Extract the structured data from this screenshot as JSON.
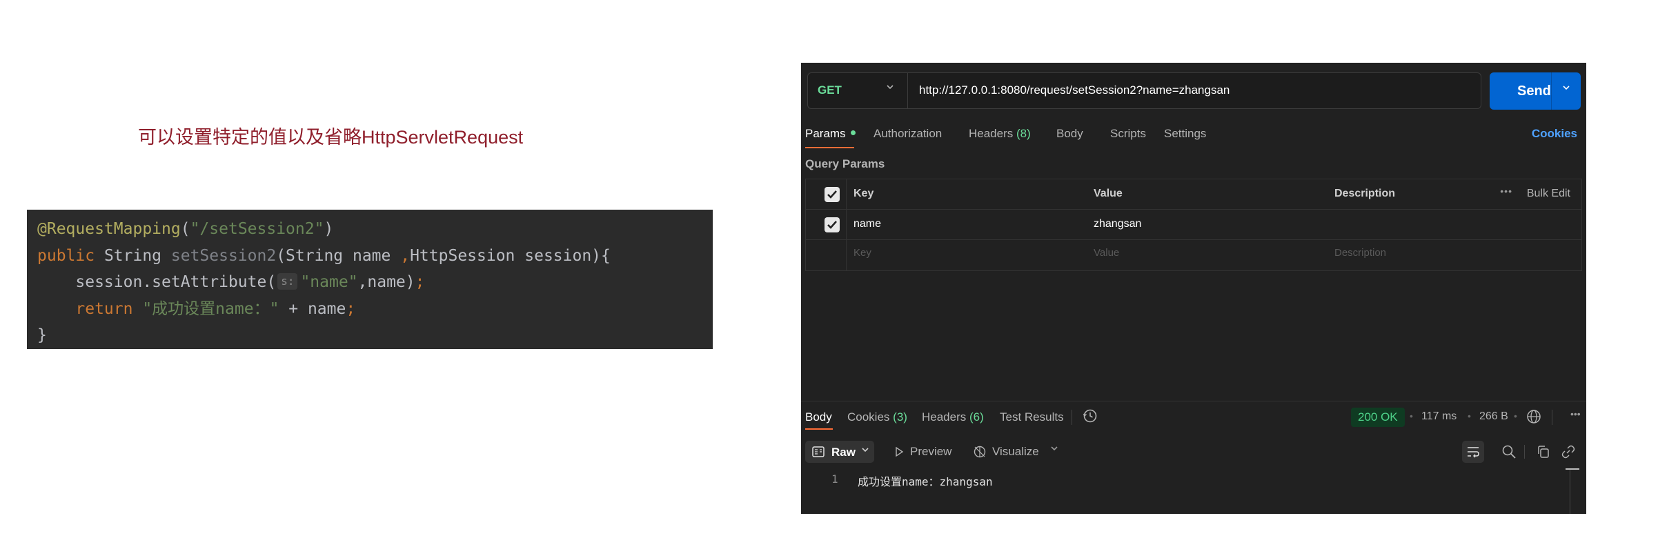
{
  "caption": "可以设置特定的值以及省略HttpServletRequest",
  "code": {
    "annotation": "@RequestMapping",
    "annotation_open": "(",
    "annotation_arg": "\"/setSession2\"",
    "annotation_close": ")",
    "kw_public": "public",
    "type_string": " String ",
    "method_name": "setSession2",
    "params": "(String name ",
    "params_comma": ",",
    "params_rest": "HttpSession session){",
    "indent": "    ",
    "set_call": "session.setAttribute(",
    "param_hint": "s:",
    "set_arg_str": "\"name\"",
    "set_arg_rest": ",name)",
    "semicolon": ";",
    "kw_return": "return",
    "ret_str": " \"成功设置name：\"",
    "ret_rest": " + name",
    "close_brace": "}"
  },
  "postman": {
    "method": "GET",
    "url": "http://127.0.0.1:8080/request/setSession2?name=zhangsan",
    "send_label": "Send",
    "tabs": {
      "params": "Params",
      "authorization": "Authorization",
      "headers": "Headers",
      "headers_count": "(8)",
      "body": "Body",
      "scripts": "Scripts",
      "settings": "Settings"
    },
    "cookies_link": "Cookies",
    "query_params_title": "Query Params",
    "table": {
      "col_key": "Key",
      "col_value": "Value",
      "col_description": "Description",
      "more": "•••",
      "bulk_edit": "Bulk Edit",
      "row_key": "name",
      "row_value": "zhangsan",
      "placeholder_key": "Key",
      "placeholder_value": "Value",
      "placeholder_description": "Description"
    },
    "response": {
      "tabs": {
        "body": "Body",
        "cookies": "Cookies",
        "cookies_count": "(3)",
        "headers": "Headers",
        "headers_count": "(6)",
        "test_results": "Test Results"
      },
      "status": "200 OK",
      "time": "117 ms",
      "size": "266 B",
      "more": "•••",
      "format_raw": "Raw",
      "preview": "Preview",
      "visualize": "Visualize",
      "line_number": "1",
      "body_text": "成功设置name：zhangsan"
    }
  },
  "colors": {
    "caption": "#8f1e2b",
    "code_bg": "#2b2b2b",
    "panel_bg": "#212121",
    "send_button": "#0265d2",
    "method_get": "#6bdd9a",
    "active_tab_underline": "#ff6c37",
    "status_ok": "#4ed38a",
    "cookies_link": "#4fa2ff"
  },
  "icons": [
    "chevron-down-icon",
    "checkbox-checked-icon",
    "history-icon",
    "globe-icon",
    "more-icon",
    "raw-format-icon",
    "play-icon",
    "visualize-icon",
    "wrap-lines-icon",
    "search-icon",
    "copy-icon",
    "link-icon"
  ]
}
